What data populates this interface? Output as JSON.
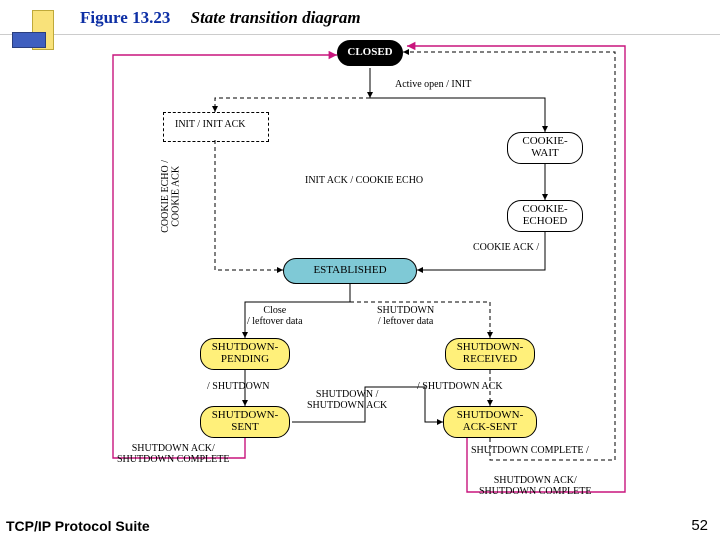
{
  "header": {
    "figure_number": "Figure 13.23",
    "title": "State transition diagram"
  },
  "footer": {
    "text": "TCP/IP Protocol Suite",
    "page": "52"
  },
  "states": {
    "closed": "CLOSED",
    "cookie_wait": "COOKIE-\nWAIT",
    "cookie_echoed": "COOKIE-\nECHOED",
    "established": "ESTABLISHED",
    "shutdown_pending": "SHUTDOWN-\nPENDING",
    "shutdown_received": "SHUTDOWN-\nRECEIVED",
    "shutdown_sent": "SHUTDOWN-\nSENT",
    "shutdown_ack_sent": "SHUTDOWN-\nACK-SENT"
  },
  "labels": {
    "active_open": "Active open / INIT",
    "init_initack": "INIT / INIT ACK",
    "cookie_echo_ack": "COOKIE ECHO /\nCOOKIE ACK",
    "initack_cookieecho": "INIT ACK / COOKIE ECHO",
    "cookie_ack": "COOKIE ACK /",
    "close_leftover": "Close\n/ leftover data",
    "shutdown_leftover": "SHUTDOWN\n/ leftover data",
    "slash_shutdown": "/ SHUTDOWN",
    "slash_shutdown_ack": "/ SHUTDOWN ACK",
    "shutdown_over_ack": "SHUTDOWN /\nSHUTDOWN ACK",
    "shutdown_ack_complete": "SHUTDOWN ACK/\nSHUTDOWN COMPLETE",
    "shutdown_complete": "SHUTDOWN COMPLETE /",
    "shutdown_ack_complete2": "SHUTDOWN ACK/\nSHUTDOWN COMPLETE"
  }
}
